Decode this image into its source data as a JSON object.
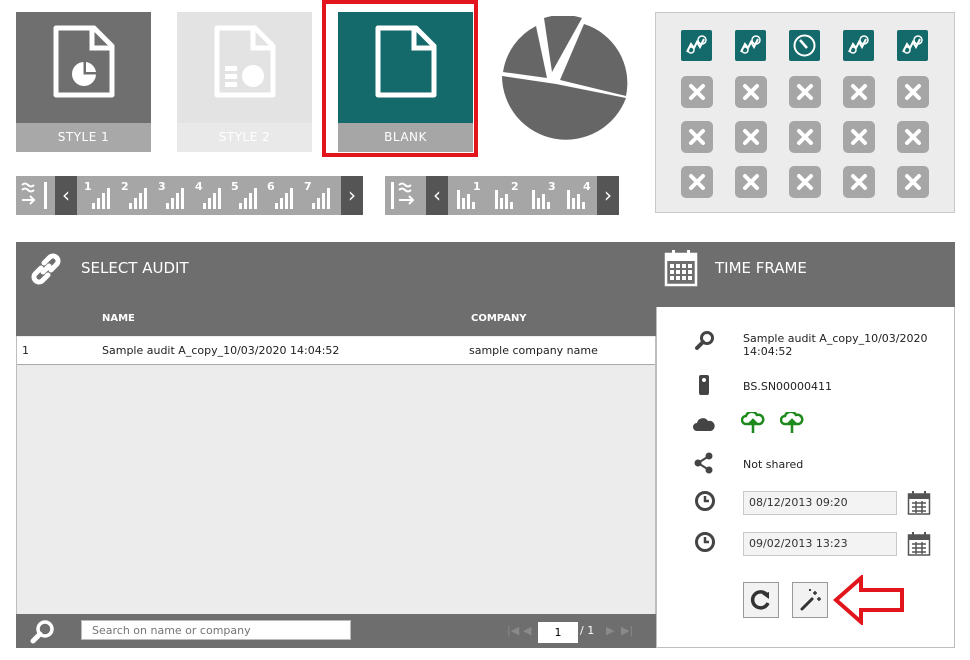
{
  "tiles": [
    {
      "label": "STYLE 1"
    },
    {
      "label": "STYLE 2"
    },
    {
      "label": "BLANK"
    }
  ],
  "sequence_bar_1": {
    "numbers": [
      "1",
      "2",
      "3",
      "4",
      "5",
      "6",
      "7"
    ]
  },
  "sequence_bar_2": {
    "numbers": [
      "1",
      "2",
      "3",
      "4"
    ]
  },
  "audit": {
    "title": "SELECT AUDIT",
    "columns": {
      "name": "NAME",
      "company": "COMPANY"
    },
    "rows": [
      {
        "index": "1",
        "name": "Sample audit A_copy_10/03/2020 14:04:52",
        "company": "sample company name"
      }
    ],
    "search_placeholder": "Search on name or company",
    "pagination": {
      "current": "1",
      "total": "/ 1"
    }
  },
  "time_frame": {
    "title": "TIME FRAME",
    "audit_name": "Sample audit A_copy_10/03/2020 14:04:52",
    "device": "BS.SN00000411",
    "sharing": "Not shared",
    "start": "08/12/2013 09:20",
    "end": "09/02/2013 13:23"
  },
  "colors": {
    "teal": "#146a6b",
    "highlight_red": "#e2141c",
    "header_gray": "#6e6e6e",
    "cloud_green": "#1e8a1e"
  },
  "icons": [
    "document-pie-icon",
    "document-table-icon",
    "blank-document-icon",
    "pie-chart-icon",
    "link-icon",
    "calendar-icon",
    "search-icon",
    "device-icon",
    "cloud-icon",
    "share-icon",
    "clock-icon",
    "refresh-icon",
    "magic-wand-icon",
    "close-icon"
  ]
}
